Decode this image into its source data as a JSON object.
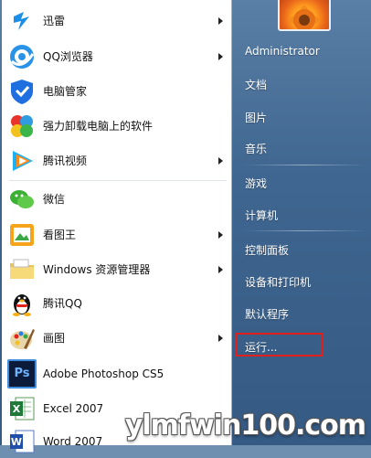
{
  "left_panel": {
    "programs": [
      {
        "label": "迅雷",
        "icon": "xunlei-icon",
        "has_submenu": true
      },
      {
        "label": "QQ浏览器",
        "icon": "qq-browser-icon",
        "has_submenu": true
      },
      {
        "label": "电脑管家",
        "icon": "pc-manager-icon",
        "has_submenu": false
      },
      {
        "label": "强力卸载电脑上的软件",
        "icon": "uninstall-icon",
        "has_submenu": false
      },
      {
        "label": "腾讯视频",
        "icon": "tencent-video-icon",
        "has_submenu": true
      },
      {
        "label": "微信",
        "icon": "wechat-icon",
        "has_submenu": false
      },
      {
        "label": "看图王",
        "icon": "image-viewer-icon",
        "has_submenu": true
      },
      {
        "label": "Windows 资源管理器",
        "icon": "explorer-icon",
        "has_submenu": true
      },
      {
        "label": "腾讯QQ",
        "icon": "qq-penguin-icon",
        "has_submenu": false
      },
      {
        "label": "画图",
        "icon": "paint-icon",
        "has_submenu": true
      },
      {
        "label": "Adobe Photoshop CS5",
        "icon": "photoshop-icon",
        "has_submenu": false
      },
      {
        "label": "Excel 2007",
        "icon": "excel-icon",
        "has_submenu": false
      },
      {
        "label": "Word 2007",
        "icon": "word-icon",
        "has_submenu": false
      }
    ]
  },
  "right_panel": {
    "items": [
      {
        "label": "Administrator"
      },
      {
        "label": "文档"
      },
      {
        "label": "图片"
      },
      {
        "label": "音乐"
      },
      {
        "label": "游戏"
      },
      {
        "label": "计算机"
      },
      {
        "label": "控制面板"
      },
      {
        "label": "设备和打印机"
      },
      {
        "label": "默认程序"
      },
      {
        "label": "运行..."
      }
    ]
  },
  "colors": {
    "highlight_border": "#e0201c",
    "right_panel_bg": "#3f6690"
  },
  "watermark": "ylmfwin100.com"
}
